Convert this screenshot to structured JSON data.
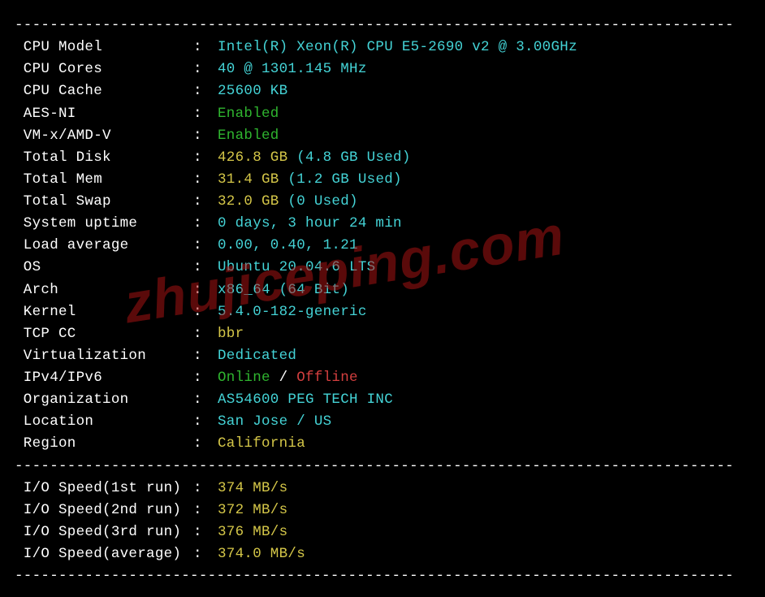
{
  "divider": "----------------------------------------------------------------------------------",
  "watermark": "zhujiceping.com",
  "section1": [
    {
      "label": "CPU Model",
      "parts": [
        {
          "text": "Intel(R) Xeon(R) CPU E5-2690 v2 @ 3.00GHz",
          "cls": "val-cyan"
        }
      ]
    },
    {
      "label": "CPU Cores",
      "parts": [
        {
          "text": "40 @ 1301.145 MHz",
          "cls": "val-cyan"
        }
      ]
    },
    {
      "label": "CPU Cache",
      "parts": [
        {
          "text": "25600 KB",
          "cls": "val-cyan"
        }
      ]
    },
    {
      "label": "AES-NI",
      "parts": [
        {
          "text": "Enabled",
          "cls": "val-green"
        }
      ]
    },
    {
      "label": "VM-x/AMD-V",
      "parts": [
        {
          "text": "Enabled",
          "cls": "val-green"
        }
      ]
    },
    {
      "label": "Total Disk",
      "parts": [
        {
          "text": "426.8 GB",
          "cls": "val-yellow"
        },
        {
          "text": " (4.8 GB Used)",
          "cls": "val-cyan"
        }
      ]
    },
    {
      "label": "Total Mem",
      "parts": [
        {
          "text": "31.4 GB",
          "cls": "val-yellow"
        },
        {
          "text": " (1.2 GB Used)",
          "cls": "val-cyan"
        }
      ]
    },
    {
      "label": "Total Swap",
      "parts": [
        {
          "text": "32.0 GB",
          "cls": "val-yellow"
        },
        {
          "text": " (0 Used)",
          "cls": "val-cyan"
        }
      ]
    },
    {
      "label": "System uptime",
      "parts": [
        {
          "text": "0 days, 3 hour 24 min",
          "cls": "val-cyan"
        }
      ]
    },
    {
      "label": "Load average",
      "parts": [
        {
          "text": "0.00, 0.40, 1.21",
          "cls": "val-cyan"
        }
      ]
    },
    {
      "label": "OS",
      "parts": [
        {
          "text": "Ubuntu 20.04.6 LTS",
          "cls": "val-cyan"
        }
      ]
    },
    {
      "label": "Arch",
      "parts": [
        {
          "text": "x86_64 (64 Bit)",
          "cls": "val-cyan"
        }
      ]
    },
    {
      "label": "Kernel",
      "parts": [
        {
          "text": "5.4.0-182-generic",
          "cls": "val-cyan"
        }
      ]
    },
    {
      "label": "TCP CC",
      "parts": [
        {
          "text": "bbr",
          "cls": "val-yellow"
        }
      ]
    },
    {
      "label": "Virtualization",
      "parts": [
        {
          "text": "Dedicated",
          "cls": "val-cyan"
        }
      ]
    },
    {
      "label": "IPv4/IPv6",
      "parts": [
        {
          "text": "Online",
          "cls": "val-green"
        },
        {
          "text": " / ",
          "cls": "val-white"
        },
        {
          "text": "Offline",
          "cls": "val-red"
        }
      ]
    },
    {
      "label": "Organization",
      "parts": [
        {
          "text": "AS54600 PEG TECH INC",
          "cls": "val-cyan"
        }
      ]
    },
    {
      "label": "Location",
      "parts": [
        {
          "text": "San Jose / US",
          "cls": "val-cyan"
        }
      ]
    },
    {
      "label": "Region",
      "parts": [
        {
          "text": "California",
          "cls": "val-yellow"
        }
      ]
    }
  ],
  "section2": [
    {
      "label": "I/O Speed(1st run)",
      "parts": [
        {
          "text": "374 MB/s",
          "cls": "val-yellow"
        }
      ]
    },
    {
      "label": "I/O Speed(2nd run)",
      "parts": [
        {
          "text": "372 MB/s",
          "cls": "val-yellow"
        }
      ]
    },
    {
      "label": "I/O Speed(3rd run)",
      "parts": [
        {
          "text": "376 MB/s",
          "cls": "val-yellow"
        }
      ]
    },
    {
      "label": "I/O Speed(average)",
      "parts": [
        {
          "text": "374.0 MB/s",
          "cls": "val-yellow"
        }
      ]
    }
  ]
}
